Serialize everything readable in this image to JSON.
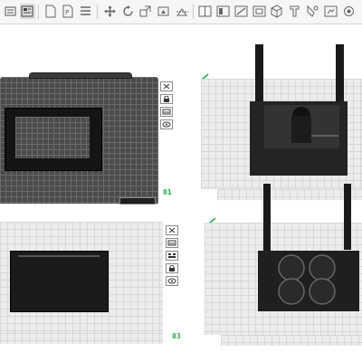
{
  "toolbar": {
    "buttons": [
      {
        "name": "add-plate-icon"
      },
      {
        "name": "arrange-icon"
      },
      {
        "name": "split-objects-icon"
      },
      {
        "name": "split-parts-icon"
      },
      {
        "name": "layers-icon"
      },
      {
        "name": "move-icon"
      },
      {
        "name": "rotate-icon"
      },
      {
        "name": "scale-icon"
      },
      {
        "name": "lay-on-face-icon"
      },
      {
        "name": "cut-icon"
      },
      {
        "name": "mesh-boolean-icon"
      },
      {
        "name": "support-paint-icon"
      },
      {
        "name": "seam-paint-icon"
      },
      {
        "name": "fuzzy-skin-icon"
      },
      {
        "name": "text-icon"
      },
      {
        "name": "measure-icon"
      },
      {
        "name": "assembly-icon"
      }
    ]
  },
  "plates": [
    {
      "id": "plate-01",
      "label": "01",
      "selected": true
    },
    {
      "id": "plate-02",
      "label": ""
    },
    {
      "id": "plate-03",
      "label": "03"
    },
    {
      "id": "plate-04",
      "label": ""
    }
  ],
  "colors": {
    "plate_label": "#1fa84a",
    "selected_plate": "#4b4b4b",
    "plate": "#ececec",
    "model": "#1e1e1e"
  }
}
